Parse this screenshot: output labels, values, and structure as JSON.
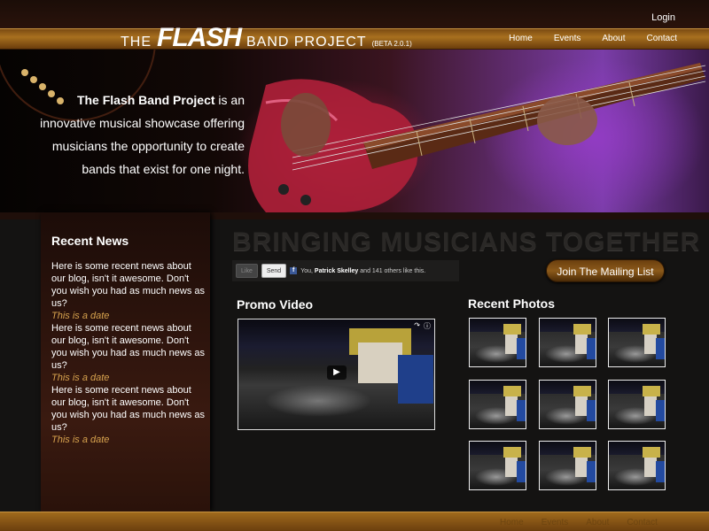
{
  "header": {
    "login": "Login",
    "logo": {
      "the": "THE",
      "flash": "FLASH",
      "band": "BAND PROJECT",
      "beta": "(BETA 2.0.1)"
    },
    "nav": [
      "Home",
      "Events",
      "About",
      "Contact"
    ]
  },
  "hero": {
    "brand": "The Flash Band Project",
    "text": " is an innovative musical showcase offering musicians the opportunity to create bands that exist for one night."
  },
  "sidebar": {
    "title": "Recent News",
    "news": [
      {
        "text": "Here is some recent news about our blog, isn't it awesome. Don't you wish you had as much news as us?",
        "date": "This is a date"
      },
      {
        "text": "Here is some recent news about our blog, isn't it awesome. Don't you wish you had as much news as us?",
        "date": "This is a date"
      },
      {
        "text": "Here is some recent news about our blog, isn't it awesome. Don't you wish you had as much news as us?",
        "date": "This is a date"
      }
    ]
  },
  "main": {
    "headline": "BRINGING MUSICIANS TOGETHER",
    "social": {
      "like": "Like",
      "send": "Send",
      "fb": "f",
      "you": "You, ",
      "name": "Patrick Skelley",
      "rest": " and 141 others like this."
    },
    "mailing": "Join The Mailing List",
    "promo_title": "Promo Video",
    "photos_title": "Recent Photos"
  },
  "footer": {
    "nav": [
      "Home",
      "Events",
      "About",
      "Contact"
    ]
  },
  "colors": {
    "accent": "#a8701f",
    "date": "#d7a24e",
    "sidebar": "#3a1a10"
  }
}
